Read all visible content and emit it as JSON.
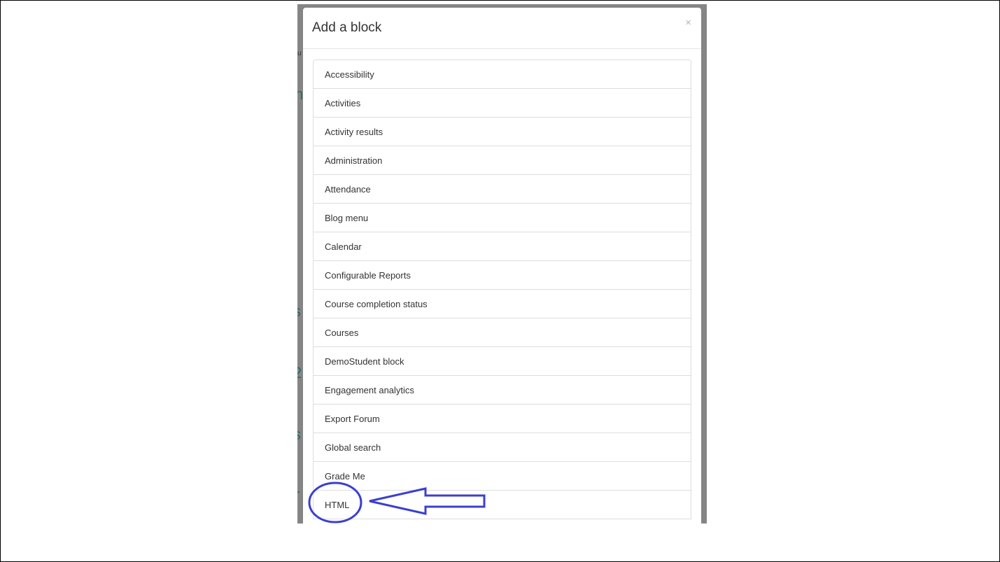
{
  "modal": {
    "title": "Add a block",
    "close_label": "×"
  },
  "blocks": [
    "Accessibility",
    "Activities",
    "Activity results",
    "Administration",
    "Attendance",
    "Blog menu",
    "Calendar",
    "Configurable Reports",
    "Course completion status",
    "Courses",
    "DemoStudent block",
    "Engagement analytics",
    "Export Forum",
    "Global search",
    "Grade Me",
    "HTML"
  ],
  "annotation": {
    "color": "#3b3fcf",
    "target": "HTML"
  }
}
